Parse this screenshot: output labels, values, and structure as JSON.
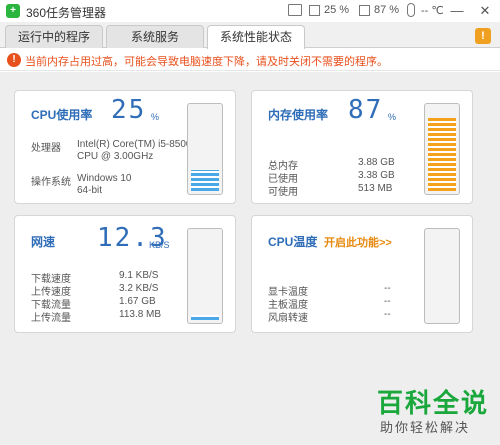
{
  "window": {
    "title": "360任务管理器",
    "cpu_usage": "25 %",
    "mem_usage": "87 %",
    "temperature": "-- ℃",
    "minimize": "—",
    "close": "✕"
  },
  "tabs": [
    {
      "label": "运行中的程序"
    },
    {
      "label": "系统服务"
    },
    {
      "label": "系统性能状态"
    }
  ],
  "warning": {
    "text": "当前内存占用过高，可能会导致电脑速度下降，请及时关闭不需要的程序。"
  },
  "cpu": {
    "title": "CPU使用率",
    "value": "25",
    "unit": "%",
    "usage_fraction": 0.25,
    "processor_label": "处理器",
    "processor_line1": "Intel(R) Core(TM) i5-8500",
    "processor_line2": "CPU @ 3.00GHz",
    "os_label": "操作系统",
    "os_line1": "Windows 10",
    "os_line2": "64-bit"
  },
  "memory": {
    "title": "内存使用率",
    "value": "87",
    "unit": "%",
    "usage_fraction": 0.87,
    "rows": [
      {
        "label": "总内存",
        "value": "3.88 GB"
      },
      {
        "label": "已使用",
        "value": "3.38 GB"
      },
      {
        "label": "可使用",
        "value": "513 MB"
      }
    ]
  },
  "network": {
    "title": "网速",
    "value": "12.3",
    "unit": "KB/S",
    "usage_fraction": 0.06,
    "rows": [
      {
        "label": "下载速度",
        "value": "9.1 KB/S"
      },
      {
        "label": "上传速度",
        "value": "3.2 KB/S"
      },
      {
        "label": "下载流量",
        "value": "1.67 GB"
      },
      {
        "label": "上传流量",
        "value": "113.8 MB"
      }
    ]
  },
  "temperature": {
    "title": "CPU温度",
    "enable_link": "开启此功能>>",
    "rows": [
      {
        "label": "显卡温度",
        "value": "--"
      },
      {
        "label": "主板温度",
        "value": "--"
      },
      {
        "label": "风扇转速",
        "value": "--"
      }
    ]
  },
  "watermark": {
    "title": "百科全说",
    "subtitle": "助你轻松解决"
  },
  "colors": {
    "accent_blue": "#2f6db8",
    "warning_orange": "#e8501c",
    "gauge_blue": "#4aa8e8",
    "gauge_orange": "#f4a21c",
    "watermark_green": "#1aa83c"
  }
}
